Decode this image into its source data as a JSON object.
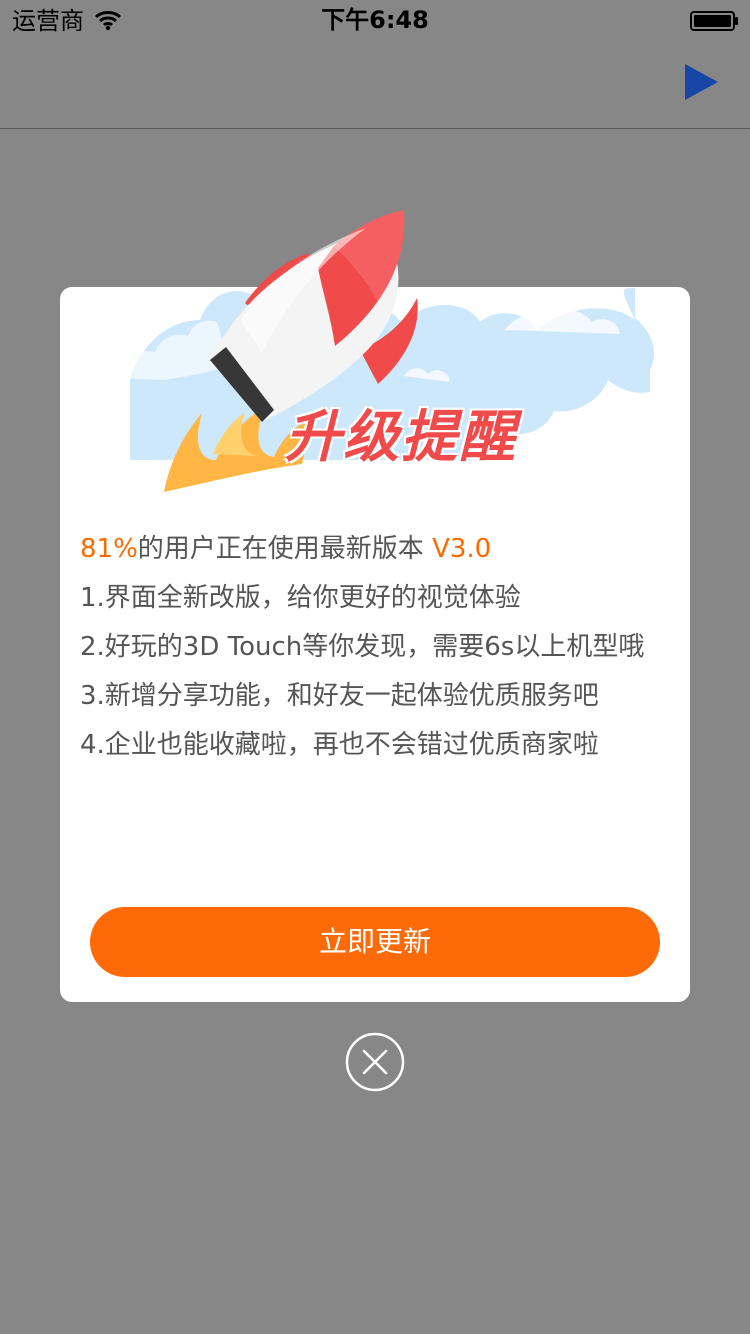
{
  "status_bar": {
    "carrier": "运营商",
    "time": "下午6:48"
  },
  "nav_bar": {
    "right_icon": "play-icon"
  },
  "update_modal": {
    "title": "升级提醒",
    "usage": {
      "percent": "81%",
      "middle_text": "的用户正在使用最新版本",
      "version": "V3.0"
    },
    "items": [
      "1.界面全新改版，给你更好的视觉体验",
      "2.好玩的3D Touch等你发现，需要6s以上机型哦",
      "3.新增分享功能，和好友一起体验优质服务吧",
      "4.企业也能收藏啦，再也不会错过优质商家啦"
    ],
    "button_label": "立即更新",
    "close_icon": "close-icon"
  },
  "colors": {
    "accent": "#ff6a08",
    "title_red": "#f04a4a",
    "overlay": "#878787"
  }
}
